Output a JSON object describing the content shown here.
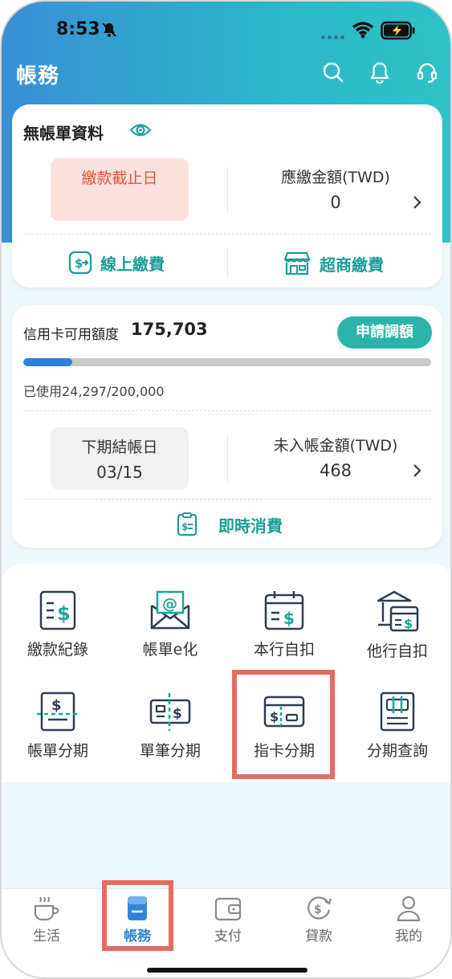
{
  "status_bar": {
    "time": "8:53"
  },
  "header": {
    "title": "帳務"
  },
  "bill_card": {
    "title": "無帳單資料",
    "due_label": "繳款截止日",
    "amount_label": "應繳金額(TWD)",
    "amount_value": "0",
    "online_pay_label": "線上繳費",
    "store_pay_label": "超商繳費"
  },
  "credit_card": {
    "available_label": "信用卡可用額度",
    "available_value": "175,703",
    "apply_button": "申請調額",
    "used_text": "已使用24,297/200,000",
    "used_fraction": 0.121,
    "next_statement_label": "下期結帳日",
    "next_statement_date": "03/15",
    "unbilled_label": "未入帳金額(TWD)",
    "unbilled_value": "468",
    "instant_spend_label": "即時消費"
  },
  "menu": {
    "items": [
      {
        "label": "繳款紀錄",
        "icon": "payment-record-icon"
      },
      {
        "label": "帳單e化",
        "icon": "ebill-icon"
      },
      {
        "label": "本行自扣",
        "icon": "autopay-calendar-icon"
      },
      {
        "label": "他行自扣",
        "icon": "other-bank-autopay-icon"
      },
      {
        "label": "帳單分期",
        "icon": "bill-installment-icon"
      },
      {
        "label": "單筆分期",
        "icon": "single-installment-icon"
      },
      {
        "label": "指卡分期",
        "icon": "card-installment-icon"
      },
      {
        "label": "分期查詢",
        "icon": "installment-query-icon"
      }
    ]
  },
  "bottom_nav": {
    "items": [
      {
        "label": "生活",
        "icon": "coffee-cup-icon"
      },
      {
        "label": "帳務",
        "icon": "account-card-icon"
      },
      {
        "label": "支付",
        "icon": "wallet-icon"
      },
      {
        "label": "貸款",
        "icon": "loan-dollar-icon"
      },
      {
        "label": "我的",
        "icon": "person-icon"
      }
    ],
    "active": "帳務"
  },
  "colors": {
    "accent_teal": "#2bb5a8",
    "accent_blue": "#2f86d9",
    "due_red": "#e0553a",
    "highlight_red": "#e86b62"
  }
}
